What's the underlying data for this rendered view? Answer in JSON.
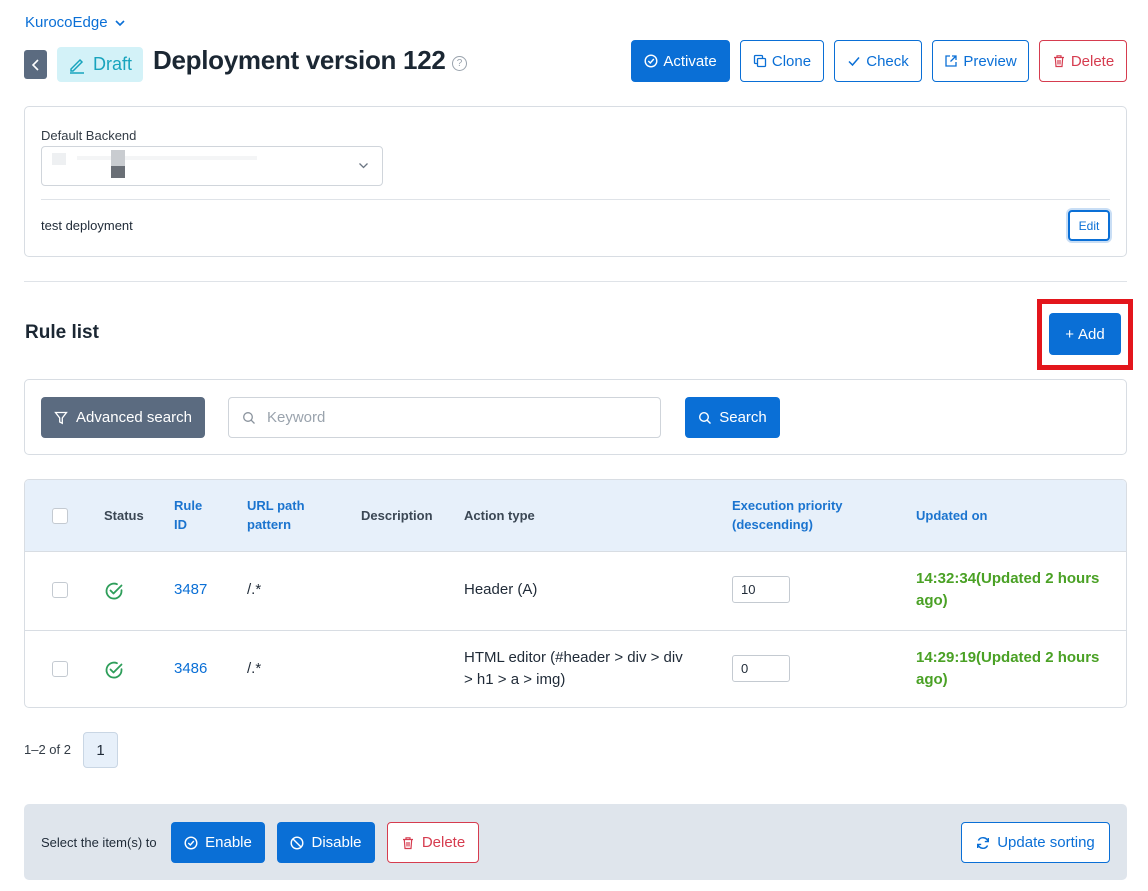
{
  "app": {
    "name": "KurocoEdge"
  },
  "header": {
    "status_badge": "Draft",
    "title": "Deployment version 122",
    "help": "?",
    "buttons": {
      "activate": "Activate",
      "clone": "Clone",
      "check": "Check",
      "preview": "Preview",
      "delete": "Delete"
    }
  },
  "backend": {
    "label": "Default Backend",
    "memo": "test deployment",
    "edit_label": "Edit"
  },
  "rule_list": {
    "title": "Rule list",
    "add_label": "Add",
    "add_plus": "+",
    "advanced_search_label": "Advanced search",
    "keyword_placeholder": "Keyword",
    "keyword_value": "",
    "search_label": "Search",
    "columns": {
      "status": "Status",
      "rule_id_1": "Rule",
      "rule_id_2": "ID",
      "url_1": "URL path",
      "url_2": "pattern",
      "description": "Description",
      "action": "Action type",
      "prio_1": "Execution priority",
      "prio_2": "(descending)",
      "updated": "Updated on"
    },
    "rows": [
      {
        "status": "enabled",
        "rule_id": "3487",
        "url_pattern": "/.*",
        "description": "",
        "action_1": "Header (A)",
        "action_2": "",
        "priority": "10",
        "updated_1": "14:32:34(Updated 2 hours",
        "updated_2": "ago)"
      },
      {
        "status": "enabled",
        "rule_id": "3486",
        "url_pattern": "/.*",
        "description": "",
        "action_1": "HTML editor (#header > div > div",
        "action_2": "> h1 > a > img)",
        "priority": "0",
        "updated_1": "14:29:19(Updated 2 hours",
        "updated_2": "ago)"
      }
    ],
    "pagination": {
      "summary": "1–2 of 2",
      "current_page": "1"
    }
  },
  "bulk_actions": {
    "label": "Select the item(s) to",
    "enable": "Enable",
    "disable": "Disable",
    "delete": "Delete",
    "update_sorting": "Update sorting"
  },
  "colors": {
    "primary": "#0a6fd6",
    "danger": "#d63c4f",
    "success": "#4aa125",
    "badge_bg": "#d3f2f8",
    "highlight": "#e3161c"
  }
}
